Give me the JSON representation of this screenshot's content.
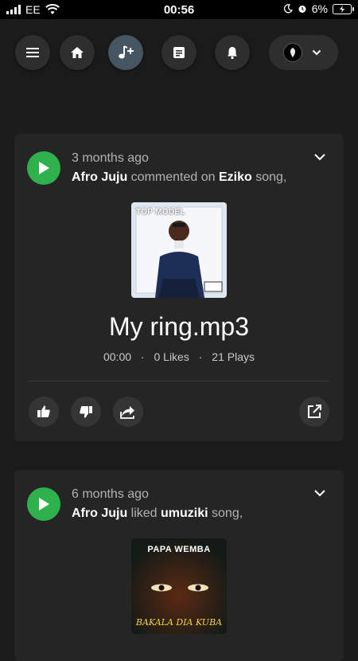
{
  "status_bar": {
    "carrier": "EE",
    "time": "00:56",
    "battery": "6%"
  },
  "nav": {
    "buttons": [
      {
        "name": "menu",
        "icon": "menu-icon"
      },
      {
        "name": "home",
        "icon": "home-icon"
      },
      {
        "name": "add-music",
        "icon": "music-plus-icon",
        "active": true
      },
      {
        "name": "feed",
        "icon": "document-icon"
      },
      {
        "name": "notifications",
        "icon": "bell-icon"
      }
    ],
    "profile_icon": "avatar-icon",
    "accent": "#455561"
  },
  "feed": [
    {
      "time_ago": "3 months ago",
      "user": "Afro Juju",
      "action": " commented on ",
      "target": "Eziko",
      "suffix": " song,",
      "cover_text": "TOP MODEL",
      "title": "My ring.mp3",
      "duration": "00:00",
      "likes": "0 Likes",
      "plays": "21 Plays",
      "separator": "·"
    },
    {
      "time_ago": "6 months ago",
      "user": "Afro Juju",
      "action": " liked ",
      "target": "umuziki",
      "suffix": " song,",
      "cover_title": "PAPA WEMBA",
      "cover_subtitle": "BAKALA DIA KUBA"
    }
  ],
  "colors": {
    "play_green": "#2fb24e",
    "card_bg": "#252525",
    "page_bg": "#1b1b1b"
  }
}
